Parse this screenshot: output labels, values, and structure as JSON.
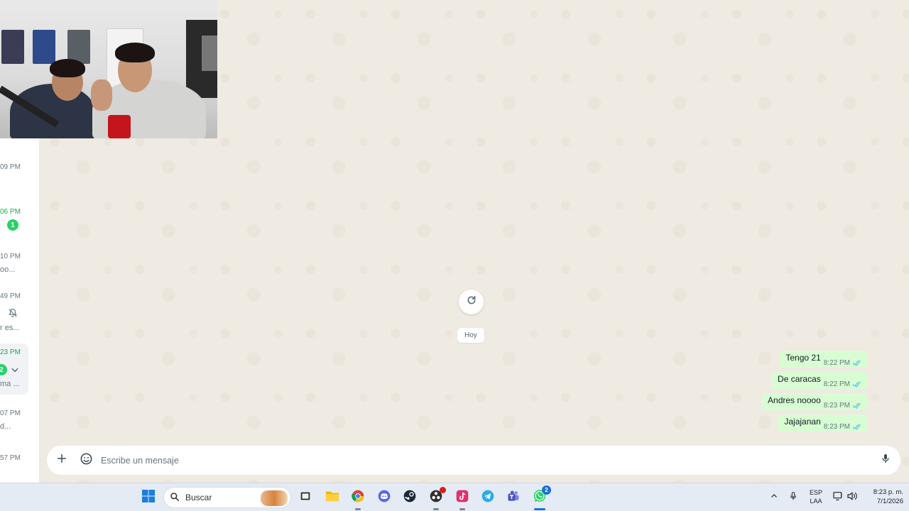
{
  "chat_list": {
    "rows": [
      {
        "time": "09 PM",
        "snippet": ""
      },
      {
        "time": "06 PM",
        "snippet": "",
        "unread": "1"
      },
      {
        "time": "10 PM",
        "snippet": "oo..."
      },
      {
        "time": "49 PM",
        "snippet": "r es..."
      },
      {
        "time": "23 PM",
        "snippet": "ma ...",
        "unread": "2"
      },
      {
        "time": "07 PM",
        "snippet": "d..."
      },
      {
        "time": "57 PM",
        "snippet": ""
      }
    ]
  },
  "conversation": {
    "date_divider": "Hoy",
    "messages": [
      {
        "text": "Tengo 21",
        "time": "8:22 PM",
        "status": "read"
      },
      {
        "text": "De caracas",
        "time": "8:22 PM",
        "status": "read"
      },
      {
        "text": "Andres noooo",
        "time": "8:23 PM",
        "status": "read"
      },
      {
        "text": "Jajajanan",
        "time": "8:23 PM",
        "status": "read"
      }
    ]
  },
  "composer": {
    "placeholder": "Escribe un mensaje",
    "value": ""
  },
  "taskbar": {
    "search_label": "Buscar",
    "whatsapp_badge": "2",
    "language_line1": "ESP",
    "language_line2": "LAA",
    "clock_time": "8:23 p. m.",
    "clock_date": "7/1/2026"
  },
  "colors": {
    "outgoing_bubble": "#d9fdd3",
    "chat_background": "#efeae2",
    "unread_badge": "#25d366",
    "read_ticks": "#53bdeb"
  }
}
